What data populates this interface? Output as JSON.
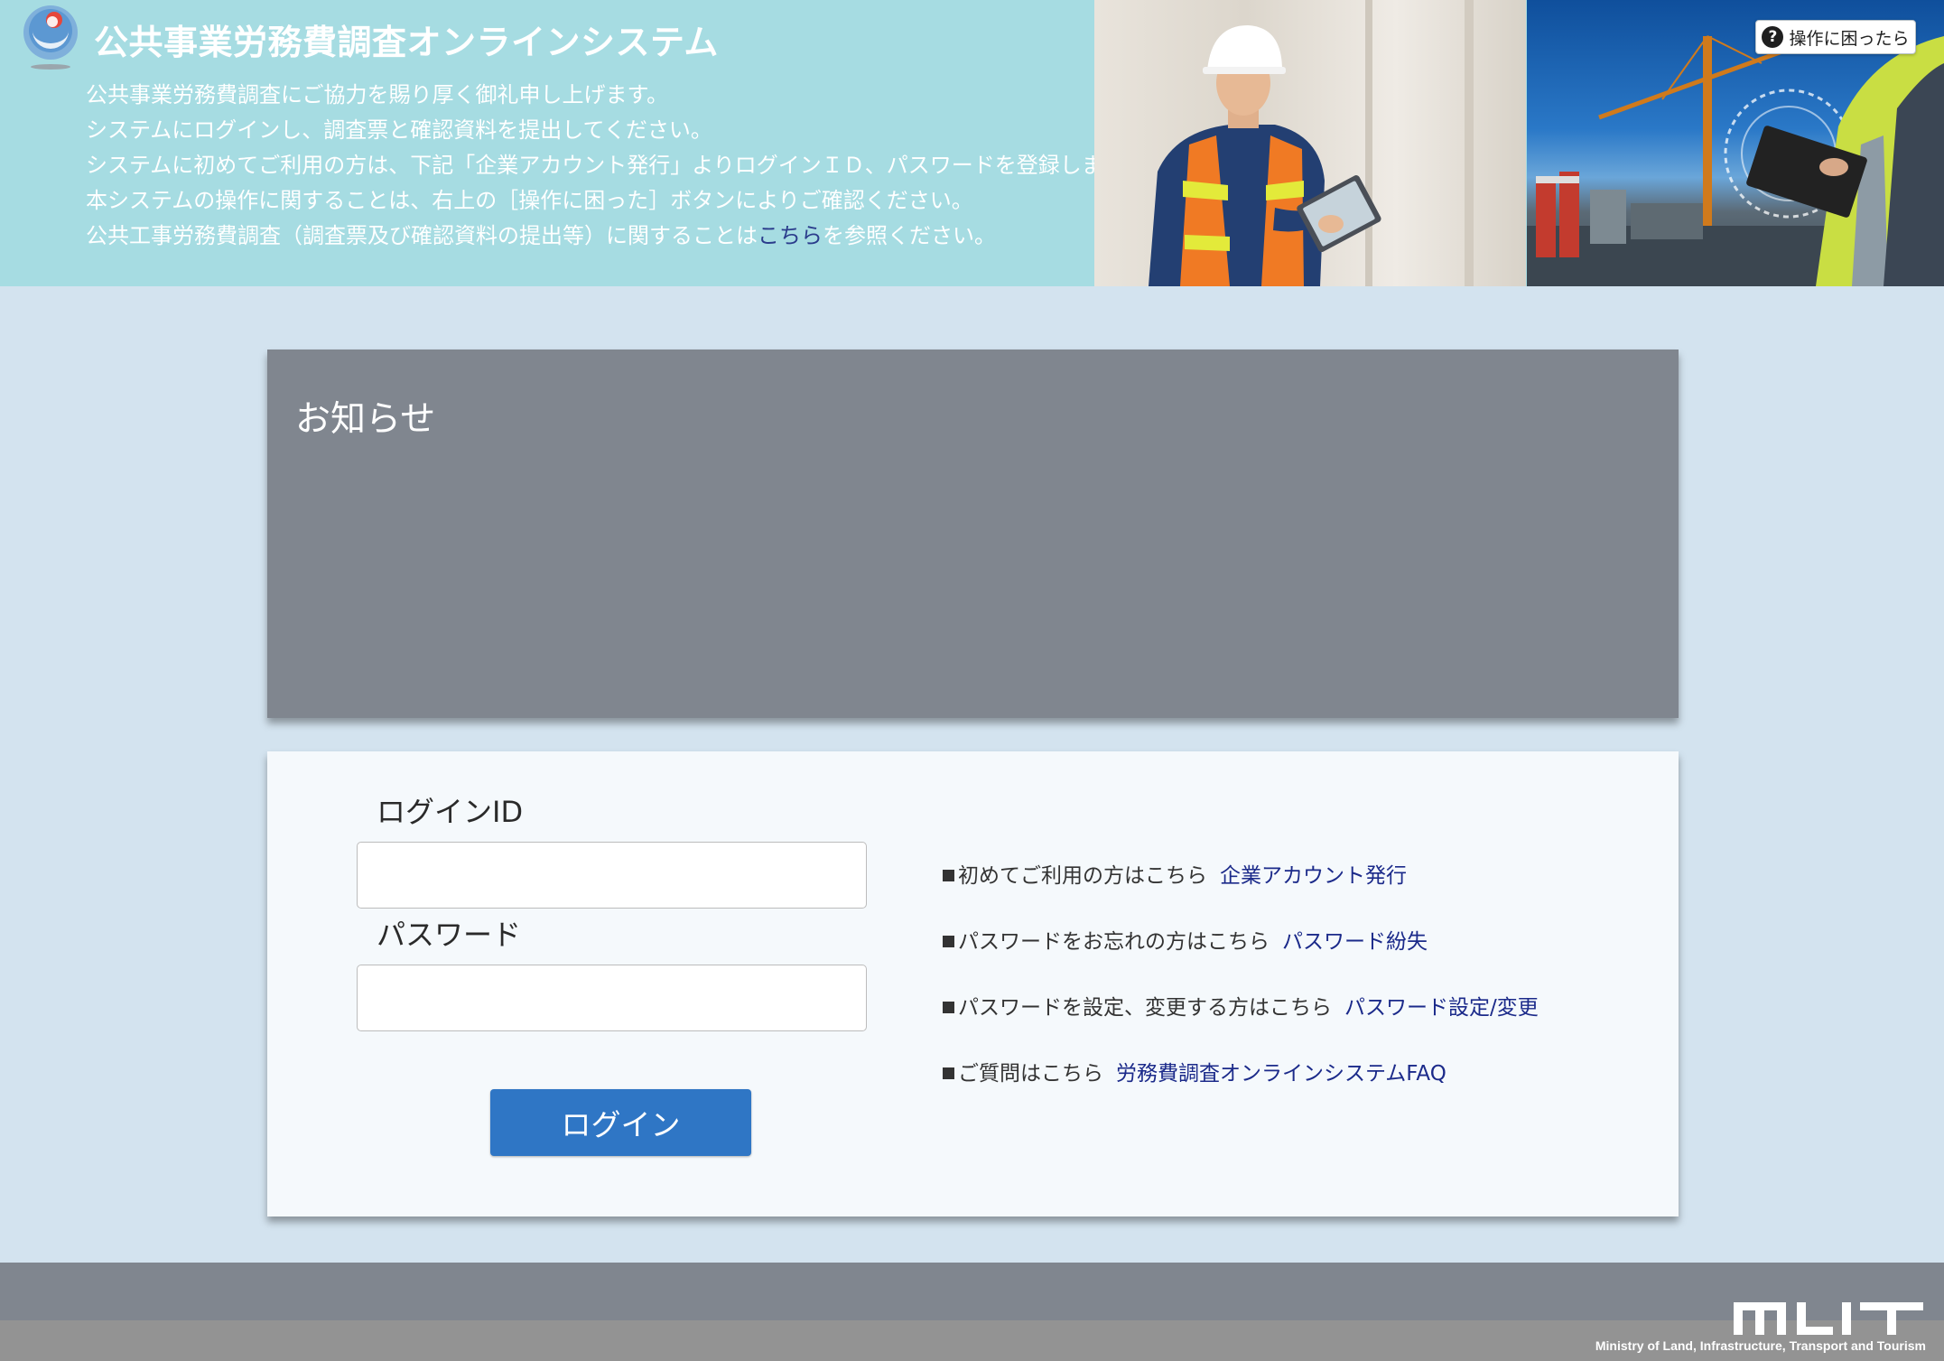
{
  "header": {
    "app_title": "公共事業労務費調査オンラインシステム",
    "intro_lines": [
      "公共事業労務費調査にご協力を賜り厚く御礼申し上げます。",
      "システムにログインし、調査票と確認資料を提出してください。",
      "システムに初めてご利用の方は、下記「企業アカウント発行」よりログインＩＤ、パスワードを登録します。",
      "本システムの操作に関することは、右上の［操作に困った］ボタンによりご確認ください。"
    ],
    "intro_last_before": "公共工事労務費調査（調査票及び確認資料の提出等）に関することは",
    "intro_last_link": "こちら",
    "intro_last_after": "を参照ください。",
    "help_button_label": "操作に困ったら",
    "help_icon_glyph": "?"
  },
  "notice": {
    "title": "お知らせ"
  },
  "login": {
    "login_id_label": "ログインID",
    "login_id_value": "",
    "password_label": "パスワード",
    "password_value": "",
    "login_button_label": "ログイン"
  },
  "links": [
    {
      "prefix": "初めてご利用の方はこちら",
      "link": "企業アカウント発行"
    },
    {
      "prefix": "パスワードをお忘れの方はこちら",
      "link": "パスワード紛失"
    },
    {
      "prefix": "パスワードを設定、変更する方はこちら",
      "link": "パスワード設定/変更"
    },
    {
      "prefix": "ご質問はこちら",
      "link": "労務費調査オンラインシステムFAQ"
    }
  ],
  "footer": {
    "logo_text": "MLIT",
    "caption": "Ministry of Land, Infrastructure, Transport and Tourism"
  },
  "colors": {
    "header_bg": "#a6dce2",
    "page_bg": "#d3e3ef",
    "notice_bg": "#80868f",
    "login_bg": "#f5f9fc",
    "login_button": "#2f76c5",
    "link": "#1b2a8a"
  }
}
